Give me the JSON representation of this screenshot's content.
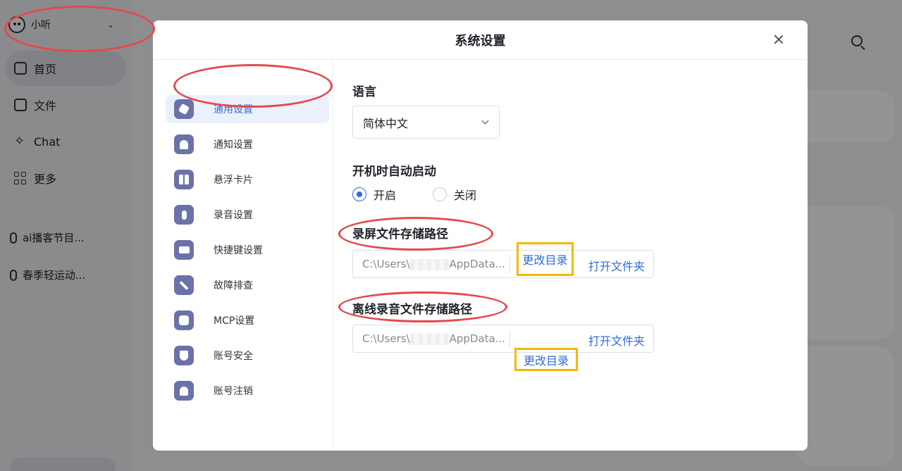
{
  "app": {
    "user": {
      "name": "小听"
    },
    "nav": [
      {
        "label": "首页",
        "icon": "home-icon"
      },
      {
        "label": "文件",
        "icon": "folder-icon"
      },
      {
        "label": "Chat",
        "icon": "sparkle-icon"
      },
      {
        "label": "更多",
        "icon": "grid-icon"
      }
    ],
    "recent": [
      {
        "label": "ai播客节目..."
      },
      {
        "label": "春季轻运动..."
      }
    ]
  },
  "modal": {
    "title": "系统设置",
    "sidebar": [
      {
        "label": "通用设置",
        "icon": "settings-hex-icon",
        "active": true
      },
      {
        "label": "通知设置",
        "icon": "bell-icon"
      },
      {
        "label": "悬浮卡片",
        "icon": "card-layout-icon"
      },
      {
        "label": "录音设置",
        "icon": "mic-gear-icon"
      },
      {
        "label": "快捷键设置",
        "icon": "keyboard-icon"
      },
      {
        "label": "故障排查",
        "icon": "wrench-icon"
      },
      {
        "label": "MCP设置",
        "icon": "mcp-icon"
      },
      {
        "label": "账号安全",
        "icon": "shield-icon"
      },
      {
        "label": "账号注销",
        "icon": "user-icon"
      }
    ],
    "language": {
      "title": "语言",
      "value": "简体中文"
    },
    "autostart": {
      "title": "开机时自动启动",
      "on_label": "开启",
      "off_label": "关闭",
      "selected": "开启"
    },
    "screen_path": {
      "title": "录屏文件存储路径",
      "prefix": "C:\\Users\\",
      "suffix": "AppData...",
      "change_label": "更改目录",
      "open_label": "打开文件夹"
    },
    "offline_path": {
      "title": "离线录音文件存储路径",
      "prefix": "C:\\Users\\",
      "suffix": "AppData...",
      "change_label": "更改目录",
      "open_label": "打开文件夹"
    }
  },
  "colors": {
    "accent": "#2f6bd8",
    "highlight_box": "#f5b800",
    "annotation": "#e5484d",
    "icon_bg": "#6b72a8"
  }
}
